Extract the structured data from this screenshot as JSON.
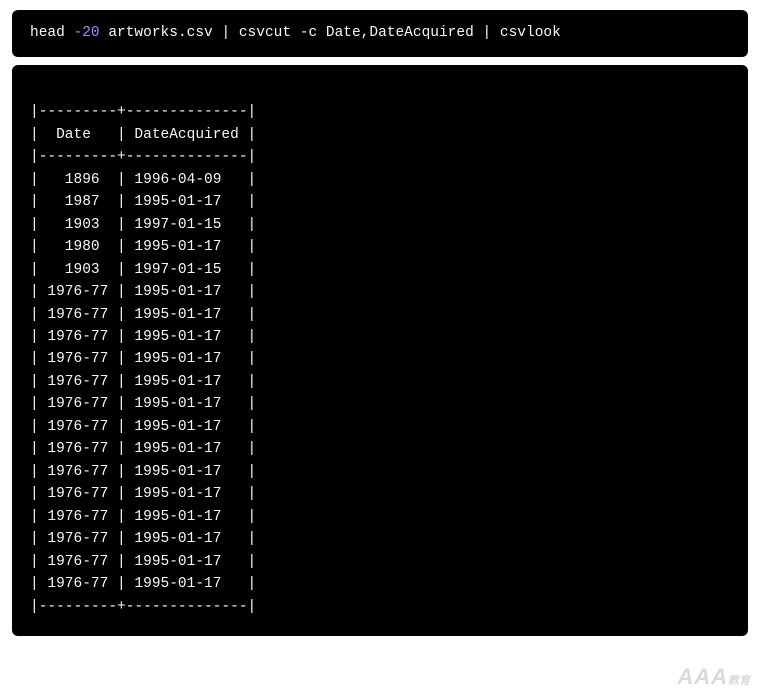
{
  "command": {
    "head": "head ",
    "flag": "-20",
    "rest": " artworks.csv | csvcut -c Date,DateAcquired | csvlook"
  },
  "table": {
    "sep": "|---------+--------------|",
    "hdr": "|  Date   | DateAcquired |",
    "rows": [
      "|   1896  | 1996-04-09   |",
      "|   1987  | 1995-01-17   |",
      "|   1903  | 1997-01-15   |",
      "|   1980  | 1995-01-17   |",
      "|   1903  | 1997-01-15   |",
      "| 1976-77 | 1995-01-17   |",
      "| 1976-77 | 1995-01-17   |",
      "| 1976-77 | 1995-01-17   |",
      "| 1976-77 | 1995-01-17   |",
      "| 1976-77 | 1995-01-17   |",
      "| 1976-77 | 1995-01-17   |",
      "| 1976-77 | 1995-01-17   |",
      "| 1976-77 | 1995-01-17   |",
      "| 1976-77 | 1995-01-17   |",
      "| 1976-77 | 1995-01-17   |",
      "| 1976-77 | 1995-01-17   |",
      "| 1976-77 | 1995-01-17   |",
      "| 1976-77 | 1995-01-17   |",
      "| 1976-77 | 1995-01-17   |"
    ]
  },
  "watermark": {
    "main": "AAA",
    "sub": "教育"
  }
}
